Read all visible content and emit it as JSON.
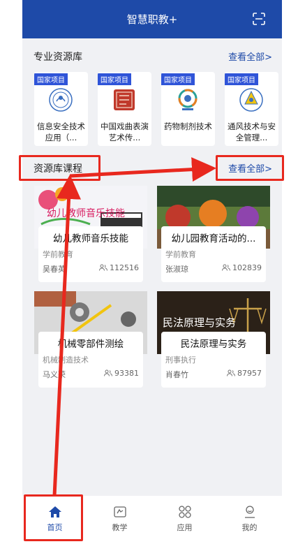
{
  "header": {
    "title": "智慧职教+"
  },
  "resources": {
    "title": "专业资源库",
    "more": "查看全部>",
    "items": [
      {
        "tag": "国家项目",
        "name": "信息安全技术应用（..."
      },
      {
        "tag": "国家项目",
        "name": "中国戏曲表演艺术传..."
      },
      {
        "tag": "国家项目",
        "name": "药物制剂技术"
      },
      {
        "tag": "国家项目",
        "name": "通风技术与安全管理..."
      }
    ]
  },
  "courses": {
    "title": "资源库课程",
    "more": "查看全部>",
    "items": [
      {
        "title": "幼儿教师音乐技能",
        "category": "学前教育",
        "teacher": "吴春英",
        "views": "112516",
        "image_text": "幼儿教师音乐技能"
      },
      {
        "title": "幼儿园教育活动的...",
        "category": "学前教育",
        "teacher": "张淑琼",
        "views": "102839",
        "image_text": ""
      },
      {
        "title": "机械零部件测绘",
        "category": "机械制造技术",
        "teacher": "马义荣",
        "views": "93381",
        "image_text": ""
      },
      {
        "title": "民法原理与实务",
        "category": "刑事执行",
        "teacher": "肖春竹",
        "views": "87957",
        "image_text": "民法原理与实务"
      }
    ]
  },
  "tabbar": {
    "items": [
      {
        "label": "首页",
        "icon": "home-icon"
      },
      {
        "label": "教学",
        "icon": "teach-icon"
      },
      {
        "label": "应用",
        "icon": "apps-icon"
      },
      {
        "label": "我的",
        "icon": "profile-icon"
      }
    ]
  },
  "colors": {
    "brand": "#1e4aa8",
    "tag": "#2f54d8",
    "highlight": "#e8281e"
  }
}
